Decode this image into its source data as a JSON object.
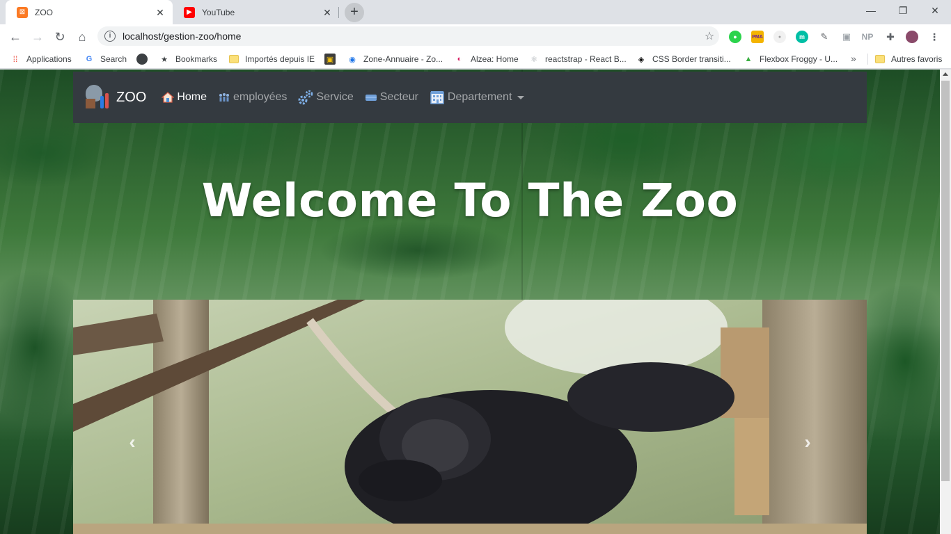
{
  "browser": {
    "tabs": [
      {
        "title": "ZOO",
        "active": true,
        "favicon": "xampp-icon",
        "favicon_color": "#fb7a24"
      },
      {
        "title": "YouTube",
        "active": false,
        "favicon": "youtube-icon",
        "favicon_color": "#ff0000"
      }
    ],
    "url": "localhost/gestion-zoo/home",
    "bookmarks": [
      {
        "label": "Applications",
        "icon": "apps-grid-icon"
      },
      {
        "label": "Search",
        "icon": "google-icon"
      },
      {
        "label": "",
        "icon": "circle-icon"
      },
      {
        "label": "Bookmarks",
        "icon": "star-icon"
      },
      {
        "label": "Importés depuis IE",
        "icon": "folder-icon"
      },
      {
        "label": "",
        "icon": "extension-icon"
      },
      {
        "label": "Zone-Annuaire - Zo...",
        "icon": "globe-icon"
      },
      {
        "label": "Alzea: Home",
        "icon": "alzea-icon"
      },
      {
        "label": "reactstrap - React B...",
        "icon": "react-icon"
      },
      {
        "label": "CSS Border transiti...",
        "icon": "codepen-icon"
      },
      {
        "label": "Flexbox Froggy - U...",
        "icon": "frog-icon"
      }
    ],
    "other_bookmarks": "Autres favoris",
    "overflow": "»"
  },
  "page": {
    "brand": "ZOO",
    "nav": [
      {
        "label": "Home",
        "icon": "house-icon",
        "active": true
      },
      {
        "label": "employées",
        "icon": "people-icon",
        "active": false
      },
      {
        "label": "Service",
        "icon": "gears-icon",
        "active": false
      },
      {
        "label": "Secteur",
        "icon": "sector-icon",
        "active": false
      },
      {
        "label": "Departement",
        "icon": "building-icon",
        "active": false,
        "dropdown": true
      }
    ],
    "hero_title": "Welcome To The Zoo",
    "carousel": {
      "prev": "‹",
      "next": "›"
    }
  },
  "colors": {
    "navbar": "#343a40",
    "accent": "#1a73e8"
  }
}
